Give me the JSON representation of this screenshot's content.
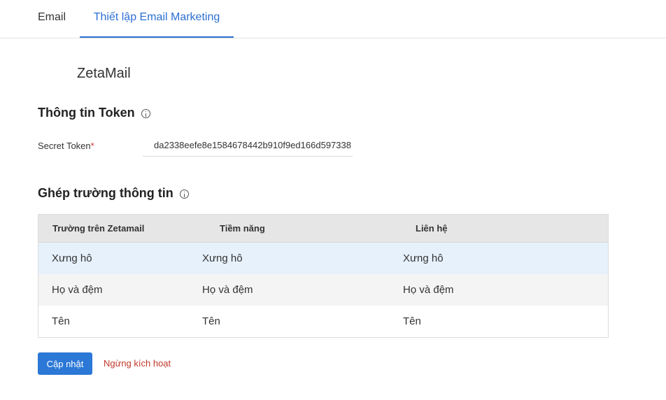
{
  "tabs": [
    {
      "label": "Email",
      "active": false
    },
    {
      "label": "Thiết lập Email Marketing",
      "active": true
    }
  ],
  "provider": {
    "name": "ZetaMail"
  },
  "token_section": {
    "title": "Thông tin Token",
    "info_icon": "info-circle-icon",
    "field_label": "Secret Token",
    "required_mark": "*",
    "value": "da2338eefe8e1584678442b910f9ed166d597338"
  },
  "mapping_section": {
    "title": "Ghép trường thông tin",
    "info_icon": "info-circle-icon",
    "headers": [
      "Trường trên Zetamail",
      "Tiềm năng",
      "Liên hệ"
    ],
    "rows": [
      [
        "Xưng hô",
        "Xưng hô",
        "Xưng hô"
      ],
      [
        "Họ và đệm",
        "Họ và đệm",
        "Họ và đệm"
      ],
      [
        "Tên",
        "Tên",
        "Tên"
      ]
    ]
  },
  "actions": {
    "update_label": "Cập nhật",
    "deactivate_label": "Ngừng kích hoạt"
  },
  "colors": {
    "accent": "#2d6fd2",
    "button": "#2b78d6",
    "danger": "#c0392b",
    "row_highlight": "#e6f1fb"
  }
}
